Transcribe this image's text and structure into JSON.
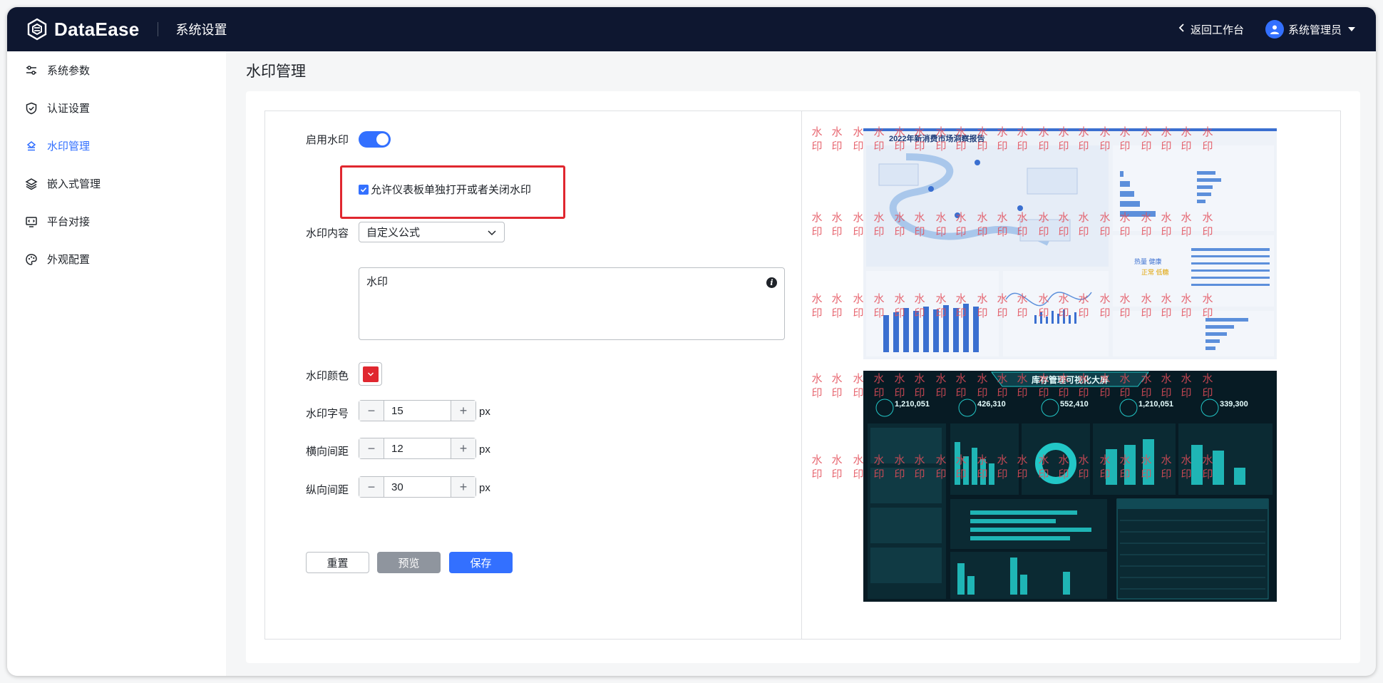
{
  "app": {
    "logo_text": "DataEase",
    "section_title": "系统设置",
    "back_label": "返回工作台",
    "user_name": "系统管理员"
  },
  "sidebar": {
    "items": [
      {
        "label": "系统参数",
        "icon": "sliders-icon",
        "active": false
      },
      {
        "label": "认证设置",
        "icon": "shield-icon",
        "active": false
      },
      {
        "label": "水印管理",
        "icon": "watermark-icon",
        "active": true
      },
      {
        "label": "嵌入式管理",
        "icon": "layers-icon",
        "active": false
      },
      {
        "label": "平台对接",
        "icon": "platform-icon",
        "active": false
      },
      {
        "label": "外观配置",
        "icon": "palette-icon",
        "active": false
      }
    ]
  },
  "page": {
    "title": "水印管理"
  },
  "form": {
    "enable_label": "启用水印",
    "enable_on": true,
    "allow_toggle_checked": true,
    "allow_toggle_label": "允许仪表板单独打开或者关闭水印",
    "content_label": "水印内容",
    "content_mode": "自定义公式",
    "content_text": "水印",
    "color_label": "水印颜色",
    "color_value": "#e0272f",
    "font_size_label": "水印字号",
    "font_size": "15",
    "h_spacing_label": "横向间距",
    "h_spacing": "12",
    "v_spacing_label": "纵向间距",
    "v_spacing": "30",
    "unit": "px",
    "reset_label": "重置",
    "preview_label": "预览",
    "save_label": "保存"
  },
  "preview": {
    "watermark_text": "水印",
    "dashboard1_title": "2022年新消费市场洞察报告",
    "dashboard2_title": "库存管理可视化大屏",
    "kpis": [
      "1,210,051",
      "426,310",
      "552,410",
      "1,210,051",
      "339,300"
    ]
  },
  "colors": {
    "accent": "#3370ff",
    "topbar": "#0e1730",
    "highlight": "#e0272f"
  }
}
